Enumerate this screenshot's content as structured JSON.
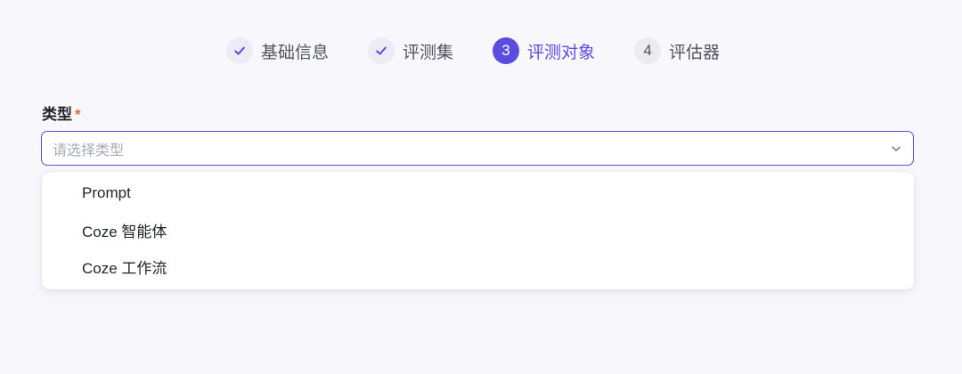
{
  "steps": [
    {
      "label": "基础信息",
      "status": "done",
      "icon": "check-icon"
    },
    {
      "label": "评测集",
      "status": "done",
      "icon": "check-icon"
    },
    {
      "label": "评测对象",
      "status": "active",
      "number": "3"
    },
    {
      "label": "评估器",
      "status": "todo",
      "number": "4"
    }
  ],
  "field": {
    "label": "类型",
    "required_mark": "*",
    "placeholder": "请选择类型",
    "icon": "chevron-down-icon"
  },
  "dropdown": {
    "options": [
      "Prompt",
      "Coze 智能体",
      "Coze 工作流"
    ]
  },
  "colors": {
    "accent": "#5c4ce0",
    "required": "#e5683a",
    "background": "#f8f8fc"
  }
}
